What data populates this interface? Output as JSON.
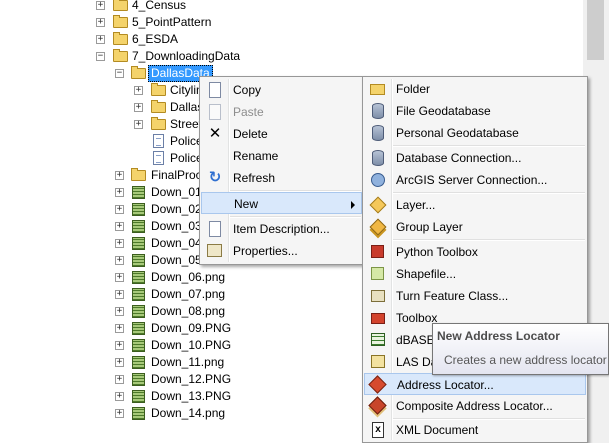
{
  "tree": {
    "items": [
      {
        "label": "4_Census",
        "expander": "+",
        "icon": "folder-icon"
      },
      {
        "label": "5_PointPattern",
        "expander": "+",
        "icon": "folder-icon"
      },
      {
        "label": "6_ESDA",
        "expander": "+",
        "icon": "folder-icon"
      },
      {
        "label": "7_DownloadingData",
        "expander": "−",
        "icon": "folder-icon"
      },
      {
        "label": "DallasData",
        "expander": "−",
        "icon": "folder-icon",
        "selected": true
      },
      {
        "label": "Citylim",
        "expander": "+",
        "icon": "folder-icon"
      },
      {
        "label": "Dallas_",
        "expander": "+",
        "icon": "folder-icon"
      },
      {
        "label": "Street",
        "expander": "+",
        "icon": "folder-icon"
      },
      {
        "label": "Police",
        "icon": "document-icon"
      },
      {
        "label": "Police",
        "icon": "document-icon"
      },
      {
        "label": "FinalProc",
        "expander": "+",
        "icon": "folder-icon"
      },
      {
        "label": "Down_01",
        "expander": "+",
        "icon": "raster-icon"
      },
      {
        "label": "Down_02",
        "expander": "+",
        "icon": "raster-icon"
      },
      {
        "label": "Down_03",
        "expander": "+",
        "icon": "raster-icon"
      },
      {
        "label": "Down_04",
        "expander": "+",
        "icon": "raster-icon"
      },
      {
        "label": "Down_05",
        "expander": "+",
        "icon": "raster-icon"
      },
      {
        "label": "Down_06.png",
        "expander": "+",
        "icon": "raster-icon"
      },
      {
        "label": "Down_07.png",
        "expander": "+",
        "icon": "raster-icon"
      },
      {
        "label": "Down_08.png",
        "expander": "+",
        "icon": "raster-icon"
      },
      {
        "label": "Down_09.PNG",
        "expander": "+",
        "icon": "raster-icon"
      },
      {
        "label": "Down_10.PNG",
        "expander": "+",
        "icon": "raster-icon"
      },
      {
        "label": "Down_11.png",
        "expander": "+",
        "icon": "raster-icon"
      },
      {
        "label": "Down_12.PNG",
        "expander": "+",
        "icon": "raster-icon"
      },
      {
        "label": "Down_13.PNG",
        "expander": "+",
        "icon": "raster-icon"
      },
      {
        "label": "Down_14.png",
        "expander": "+",
        "icon": "raster-icon"
      }
    ]
  },
  "context_menu": {
    "items": [
      {
        "label": "Copy",
        "icon": "copy-icon",
        "enabled": true
      },
      {
        "label": "Paste",
        "icon": "paste-icon",
        "enabled": false
      },
      {
        "label": "Delete",
        "icon": "delete-icon",
        "enabled": true
      },
      {
        "label": "Rename",
        "icon": "",
        "enabled": true
      },
      {
        "label": "Refresh",
        "icon": "refresh-icon",
        "enabled": true
      },
      {
        "label": "New",
        "icon": "",
        "enabled": true,
        "submenu": true,
        "hovered": true
      },
      {
        "label": "Item Description...",
        "icon": "item-description-icon",
        "enabled": true
      },
      {
        "label": "Properties...",
        "icon": "properties-icon",
        "enabled": true
      }
    ]
  },
  "new_submenu": {
    "items": [
      {
        "label": "Folder",
        "icon": "folder-icon"
      },
      {
        "label": "File Geodatabase",
        "icon": "file-geodatabase-icon"
      },
      {
        "label": "Personal Geodatabase",
        "icon": "personal-geodatabase-icon"
      },
      {
        "label": "Database Connection...",
        "icon": "database-connection-icon"
      },
      {
        "label": "ArcGIS Server Connection...",
        "icon": "arcgis-server-icon"
      },
      {
        "label": "Layer...",
        "icon": "layer-icon"
      },
      {
        "label": "Group Layer",
        "icon": "group-layer-icon"
      },
      {
        "label": "Python Toolbox",
        "icon": "python-toolbox-icon"
      },
      {
        "label": "Shapefile...",
        "icon": "shapefile-icon"
      },
      {
        "label": "Turn Feature Class...",
        "icon": "turn-feature-class-icon"
      },
      {
        "label": "Toolbox",
        "icon": "toolbox-icon"
      },
      {
        "label": "dBASE",
        "icon": "dbase-table-icon"
      },
      {
        "label": "LAS Da",
        "icon": "las-dataset-icon"
      },
      {
        "label": "Address Locator...",
        "icon": "address-locator-icon",
        "hovered": true
      },
      {
        "label": "Composite Address Locator...",
        "icon": "composite-address-locator-icon"
      },
      {
        "label": "XML Document",
        "icon": "xml-document-icon"
      }
    ]
  },
  "tooltip": {
    "title": "New Address Locator",
    "description": "Creates a new address locator"
  },
  "icons": {
    "xml_glyph": "x",
    "delete_glyph": "✕",
    "refresh_glyph": "↻"
  },
  "colors": {
    "selection": "#3399ff",
    "menu_hover": "#d9e8fb",
    "menu_bg": "#f5f5f5"
  }
}
